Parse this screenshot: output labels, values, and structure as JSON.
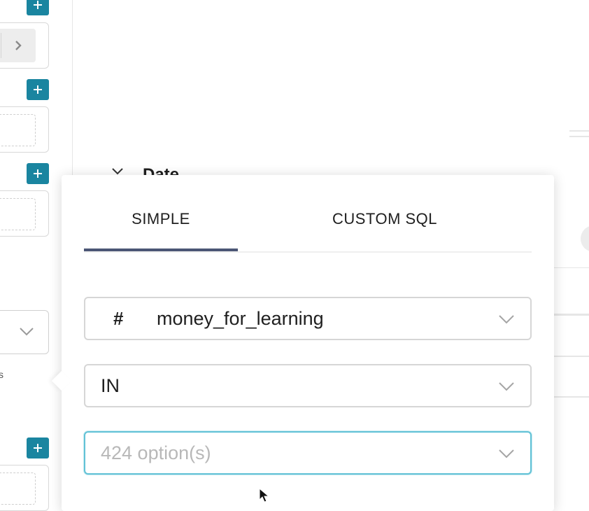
{
  "left_panel": {
    "add_buttons": [
      "+",
      "+",
      "+",
      "+"
    ],
    "side_fragment": "s"
  },
  "background": {
    "section_title": "Date"
  },
  "filter_popover": {
    "tabs": [
      {
        "label": "SIMPLE",
        "active": true
      },
      {
        "label": "CUSTOM SQL",
        "active": false
      }
    ],
    "column": {
      "type_icon": "#",
      "name": "money_for_learning"
    },
    "operator": {
      "value": "IN"
    },
    "values": {
      "placeholder": "424 option(s)"
    }
  },
  "colors": {
    "accent": "#1a85a0",
    "tab_indicator": "#4b5675",
    "focus_border": "#62c2d6"
  },
  "icons": [
    "plus-icon",
    "chevron-right-icon",
    "chevron-down-icon",
    "mouse-cursor-icon"
  ]
}
